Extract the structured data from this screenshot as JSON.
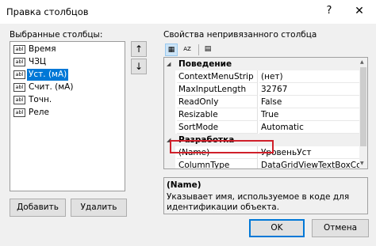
{
  "window": {
    "title": "Правка столбцов",
    "help": "?",
    "close": "✕"
  },
  "left": {
    "label": "Выбранные столбцы:",
    "columns": [
      {
        "icon": "abl",
        "name": "Время"
      },
      {
        "icon": "abl",
        "name": "ЧЗЦ"
      },
      {
        "icon": "abl",
        "name": "Уст. (мА)"
      },
      {
        "icon": "abl",
        "name": "Счит. (мА)"
      },
      {
        "icon": "abl",
        "name": "Точн."
      },
      {
        "icon": "abl",
        "name": "Реле"
      }
    ],
    "selected_index": 2,
    "move_up": "↑",
    "move_down": "↓",
    "add_button": "Добавить",
    "remove_button": "Удалить"
  },
  "right": {
    "label": "Свойства непривязанного столбца",
    "toolbar": {
      "categorized": "▦",
      "alphabetical": "AZ",
      "pages": "▤"
    },
    "categories": [
      {
        "name": "Поведение",
        "rows": [
          {
            "name": "ContextMenuStrip",
            "value": "(нет)"
          },
          {
            "name": "MaxInputLength",
            "value": "32767"
          },
          {
            "name": "ReadOnly",
            "value": "False"
          },
          {
            "name": "Resizable",
            "value": "True"
          },
          {
            "name": "SortMode",
            "value": "Automatic"
          }
        ]
      },
      {
        "name": "Разработка",
        "rows": [
          {
            "name": "(Name)",
            "value": "УровеньУст"
          },
          {
            "name": "ColumnType",
            "value": "DataGridViewTextBoxColum"
          }
        ]
      }
    ],
    "description": {
      "title": "(Name)",
      "text": "Указывает имя, используемое в коде для идентификации объекта."
    }
  },
  "buttons": {
    "ok": "OK",
    "cancel": "Отмена"
  },
  "colors": {
    "selection": "#0078d7",
    "highlight_border": "#d0202a"
  }
}
